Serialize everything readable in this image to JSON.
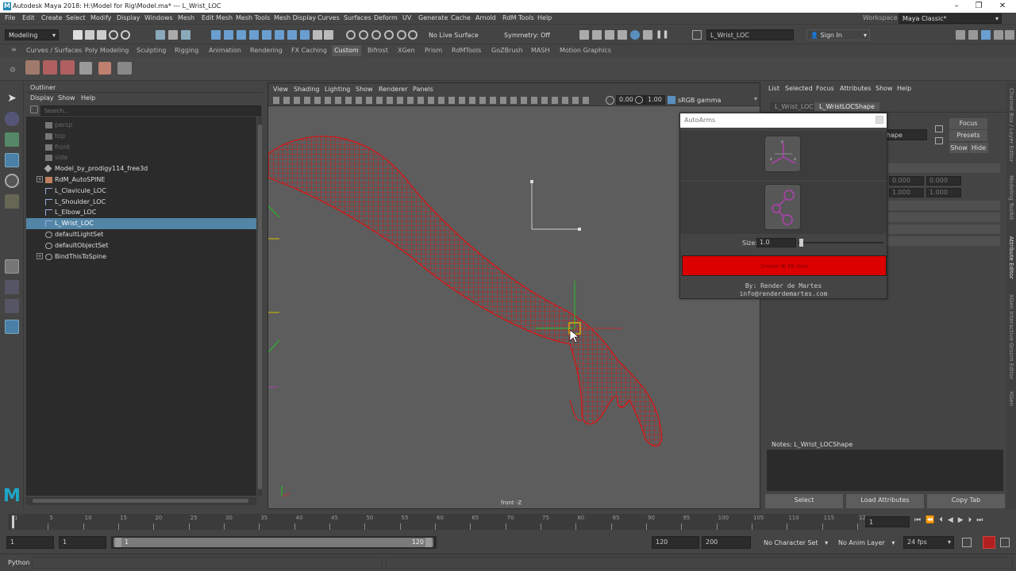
{
  "window": {
    "title": "Autodesk Maya 2018: H:\\Model for Rig\\Model.ma*  ---  L_Wrist_LOC",
    "controls": [
      "–",
      "❐",
      "✕"
    ]
  },
  "menubar": {
    "items": [
      "File",
      "Edit",
      "Create",
      "Select",
      "Modify",
      "Display",
      "Windows",
      "Mesh",
      "Edit Mesh",
      "Mesh Tools",
      "Mesh Display",
      "Curves",
      "Surfaces",
      "Deform",
      "UV",
      "Generate",
      "Cache",
      "Arnold",
      "RdM Tools",
      "Help"
    ],
    "workspace_label": "Workspace :",
    "workspace_value": "Maya Classic*"
  },
  "statusline": {
    "mode": "Modeling",
    "live_surface": "No Live Surface",
    "symmetry": "Symmetry: Off",
    "object_field": "L_Wrist_LOC",
    "sign_in": "Sign In"
  },
  "shelf": {
    "tabs": [
      "Curves / Surfaces",
      "Poly Modeling",
      "Sculpting",
      "Rigging",
      "Animation",
      "Rendering",
      "FX Caching",
      "Custom",
      "Bifrost",
      "XGen",
      "Prism",
      "RdMTools",
      "GoZBrush",
      "MASH",
      "Motion Graphics"
    ],
    "active_tab": "Custom"
  },
  "outliner": {
    "title": "Outliner",
    "menu": [
      "Display",
      "Show",
      "Help"
    ],
    "search_placeholder": "Search...",
    "items": [
      {
        "label": "persp",
        "dim": true,
        "icon": "camera-icon",
        "expand": false,
        "selected": false
      },
      {
        "label": "top",
        "dim": true,
        "icon": "camera-icon",
        "expand": false,
        "selected": false
      },
      {
        "label": "front",
        "dim": true,
        "icon": "camera-icon",
        "expand": false,
        "selected": false
      },
      {
        "label": "side",
        "dim": true,
        "icon": "camera-icon",
        "expand": false,
        "selected": false
      },
      {
        "label": "Model_by_prodigy114_free3d",
        "dim": false,
        "icon": "mesh-icon",
        "expand": false,
        "selected": false
      },
      {
        "label": "RdM_AutoSPINE",
        "dim": false,
        "icon": "group-icon",
        "expand": true,
        "selected": false
      },
      {
        "label": "L_Clavicule_LOC",
        "dim": false,
        "icon": "locator-icon",
        "expand": false,
        "selected": false
      },
      {
        "label": "L_Shoulder_LOC",
        "dim": false,
        "icon": "locator-icon",
        "expand": false,
        "selected": false
      },
      {
        "label": "L_Elbow_LOC",
        "dim": false,
        "icon": "locator-icon",
        "expand": false,
        "selected": false
      },
      {
        "label": "L_Wrist_LOC",
        "dim": false,
        "icon": "locator-icon",
        "expand": false,
        "selected": true
      },
      {
        "label": "defaultLightSet",
        "dim": false,
        "icon": "set-icon",
        "expand": false,
        "selected": false
      },
      {
        "label": "defaultObjectSet",
        "dim": false,
        "icon": "set-icon",
        "expand": false,
        "selected": false
      },
      {
        "label": "BindThisToSpine",
        "dim": false,
        "icon": "set-icon",
        "expand": true,
        "selected": false
      }
    ]
  },
  "viewport": {
    "menu": [
      "View",
      "Shading",
      "Lighting",
      "Show",
      "Renderer",
      "Panels"
    ],
    "near_value": "0.00",
    "far_value": "1.00",
    "color_space": "sRGB gamma",
    "camera_label": "front -Z"
  },
  "attribute_editor": {
    "menu": [
      "List",
      "Selected",
      "Focus",
      "Attributes",
      "Show",
      "Help"
    ],
    "tabs": [
      "L_Wrist_LOC",
      "L_WristLOCShape"
    ],
    "shape_field": "hape",
    "buttons": {
      "focus": "Focus",
      "presets": "Presets",
      "show": "Show",
      "hide": "Hide"
    },
    "fields": [
      "0.000",
      "0.000",
      "1.000",
      "1.000"
    ],
    "notes_label": "Notes:  L_Wrist_LOCShape",
    "bottom_buttons": [
      "Select",
      "Load Attributes",
      "Copy Tab"
    ],
    "side_tabs": [
      "Channel Box / Layer Editor",
      "Modeling Toolkit",
      "Attribute Editor",
      "XGen Interactive Groom Editor",
      "XGen"
    ]
  },
  "autoarms": {
    "title": "AutoArms",
    "size_label": "Size:",
    "size_value": "1.0",
    "size_level": 0.12,
    "create_button": "Create IK FK Arm",
    "credit_line1": "By: Render de Martes",
    "credit_line2": "info@renderdemartes.com",
    "accent": "#dd0000"
  },
  "timeline": {
    "ticks": [
      "1",
      "5",
      "10",
      "15",
      "20",
      "25",
      "30",
      "35",
      "40",
      "45",
      "50",
      "55",
      "60",
      "65",
      "70",
      "75",
      "80",
      "85",
      "90",
      "95",
      "100",
      "105",
      "110",
      "115",
      "12"
    ],
    "current_frame": "1"
  },
  "range": {
    "start": "1",
    "anim_start": "1",
    "range_start": "1",
    "range_end": "120",
    "end": "120",
    "anim_end": "200",
    "character_set": "No Character Set",
    "anim_layer": "No Anim Layer",
    "fps": "24 fps"
  },
  "command_line": {
    "language": "Python"
  }
}
